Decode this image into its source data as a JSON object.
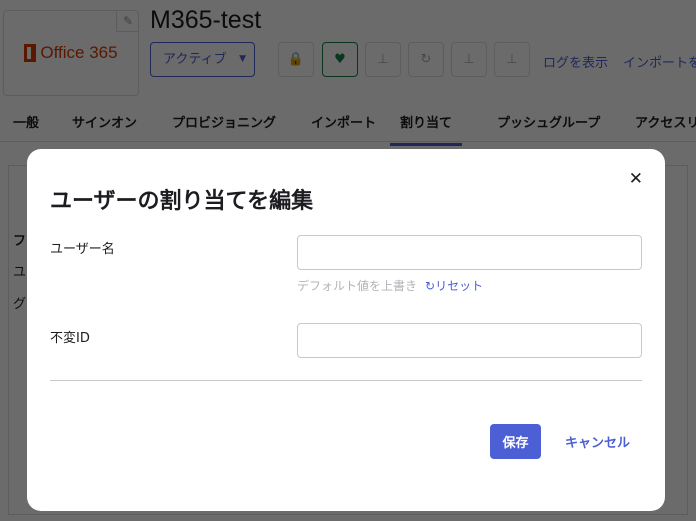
{
  "app": {
    "logo_text": "Office 365",
    "title": "M365-test",
    "status": "アクティブ",
    "links": [
      "ログを表示",
      "インポートを"
    ]
  },
  "tabs": [
    "一般",
    "サインオン",
    "プロビジョニング",
    "インポート",
    "割り当て",
    "プッシュグループ",
    "アクセスリ"
  ],
  "selected_tab": "割り当て",
  "background_rows": [
    "フ",
    "ユ",
    "グ"
  ],
  "modal": {
    "title": "ユーザーの割り当てを編集",
    "username_label": "ユーザー名",
    "username_value": "",
    "override_hint": "デフォルト値を上書き",
    "reset_label": "リセット",
    "immutable_id_label": "不変ID",
    "immutable_id_value": "",
    "save_label": "保存",
    "cancel_label": "キャンセル"
  },
  "colors": {
    "accent": "#4c5fd5",
    "brand": "#d83b01"
  }
}
